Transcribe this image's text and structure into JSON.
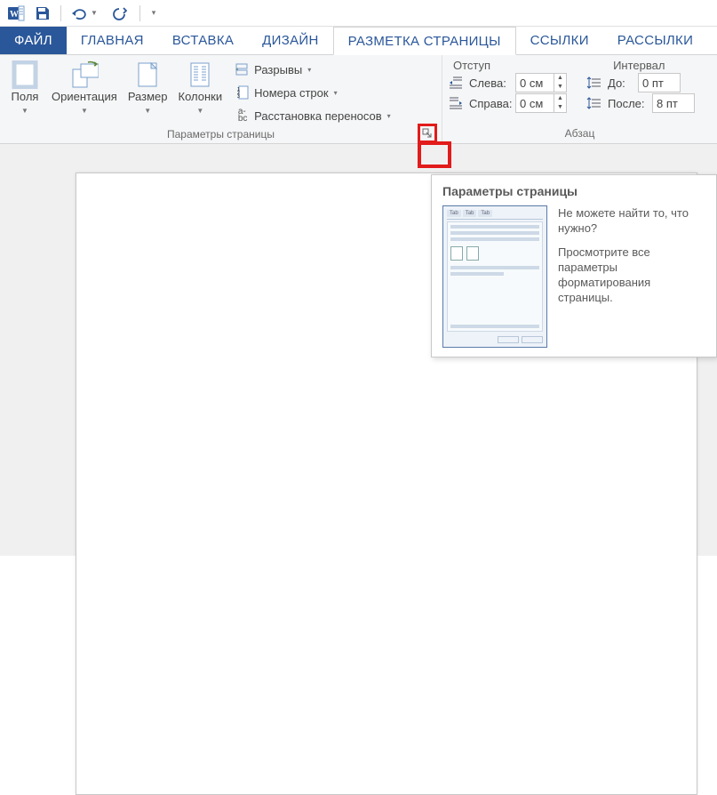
{
  "qat": {
    "app_icon": "word-icon",
    "save": "save-icon",
    "undo": "undo-icon",
    "redo": "redo-icon"
  },
  "tabs": {
    "file": "ФАЙЛ",
    "home": "ГЛАВНАЯ",
    "insert": "ВСТАВКА",
    "design": "ДИЗАЙН",
    "layout": "РАЗМЕТКА СТРАНИЦЫ",
    "references": "ССЫЛКИ",
    "mailings": "РАССЫЛКИ"
  },
  "ribbon": {
    "page_setup": {
      "margins": "Поля",
      "orientation": "Ориентация",
      "size": "Размер",
      "columns": "Колонки",
      "breaks": "Разрывы",
      "line_numbers": "Номера строк",
      "hyphenation": "Расстановка переносов",
      "group_label": "Параметры страницы"
    },
    "paragraph": {
      "indent_header": "Отступ",
      "spacing_header": "Интервал",
      "left_label": "Слева:",
      "right_label": "Справа:",
      "before_label": "До:",
      "after_label": "После:",
      "left_value": "0 см",
      "right_value": "0 см",
      "before_value": "0 пт",
      "after_value": "8 пт",
      "group_label": "Абзац"
    }
  },
  "tooltip": {
    "title": "Параметры страницы",
    "line1": "Не можете найти то, что нужно?",
    "line2": "Просмотрите все параметры форматирования страницы."
  }
}
